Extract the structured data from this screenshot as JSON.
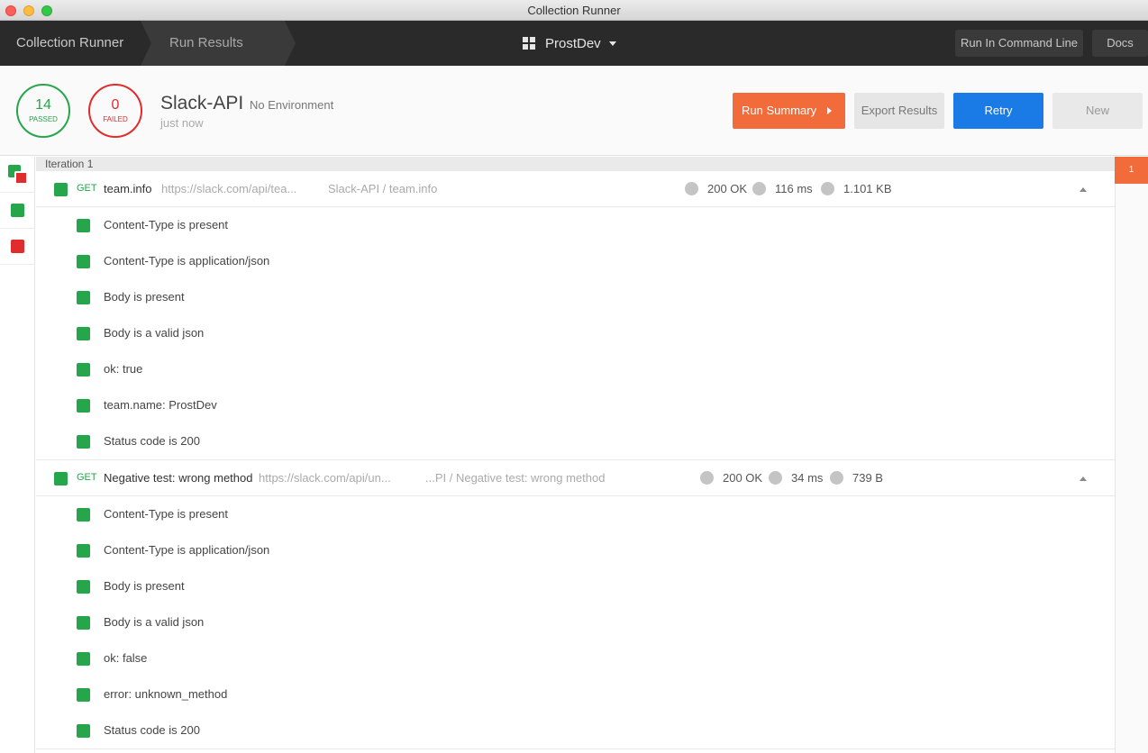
{
  "window": {
    "title": "Collection Runner"
  },
  "header": {
    "breadcrumb": [
      "Collection Runner",
      "Run Results"
    ],
    "workspace": "ProstDev",
    "run_cli_label": "Run In Command Line",
    "docs_label": "Docs"
  },
  "summary": {
    "passed_count": "14",
    "passed_label": "PASSED",
    "failed_count": "0",
    "failed_label": "FAILED",
    "collection_name": "Slack-API",
    "environment": "No Environment",
    "time": "just now",
    "run_summary_label": "Run Summary",
    "export_label": "Export Results",
    "retry_label": "Retry",
    "new_label": "New"
  },
  "iteration": {
    "label": "Iteration 1",
    "marker": "1"
  },
  "requests": [
    {
      "method": "GET",
      "name": "team.info",
      "url": "https://slack.com/api/tea...",
      "path": "Slack-API / team.info",
      "status": "200 OK",
      "time": "116 ms",
      "size": "1.101 KB",
      "tests": [
        "Content-Type is present",
        "Content-Type is application/json",
        "Body is present",
        "Body is a valid json",
        "ok: true",
        "team.name: ProstDev",
        "Status code is 200"
      ]
    },
    {
      "method": "GET",
      "name": "Negative test: wrong method",
      "url": "https://slack.com/api/un...",
      "path": "...PI / Negative test: wrong method",
      "status": "200 OK",
      "time": "34 ms",
      "size": "739 B",
      "tests": [
        "Content-Type is present",
        "Content-Type is application/json",
        "Body is present",
        "Body is a valid json",
        "ok: false",
        "error: unknown_method",
        "Status code is 200"
      ]
    }
  ],
  "colors": {
    "pass": "#26a64b",
    "fail": "#e02c2c",
    "accent": "#f26b3a",
    "primary": "#1a7ae6"
  }
}
